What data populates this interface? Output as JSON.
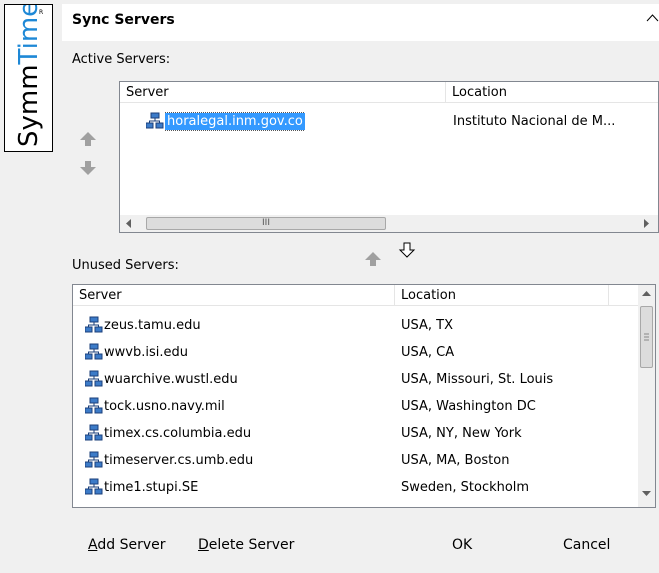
{
  "logo": {
    "text": "SymmTime",
    "mark": "R"
  },
  "section": {
    "title": "Sync Servers"
  },
  "active": {
    "label": "Active Servers:",
    "columns": [
      "Server",
      "Location"
    ],
    "rows": [
      {
        "server": "horalegal.inm.gov.co",
        "location": "Instituto Nacional de M..."
      }
    ],
    "hscroll_grip": "III"
  },
  "unused": {
    "label": "Unused Servers:",
    "columns": [
      "Server",
      "Location"
    ],
    "rows": [
      {
        "server": "zeus.tamu.edu",
        "location": "USA, TX"
      },
      {
        "server": "wwvb.isi.edu",
        "location": "USA, CA"
      },
      {
        "server": "wuarchive.wustl.edu",
        "location": "USA, Missouri, St. Louis"
      },
      {
        "server": "tock.usno.navy.mil",
        "location": "USA, Washington DC"
      },
      {
        "server": "timex.cs.columbia.edu",
        "location": "USA, NY, New York"
      },
      {
        "server": "timeserver.cs.umb.edu",
        "location": "USA, MA, Boston"
      },
      {
        "server": "time1.stupi.SE",
        "location": "Sweden, Stockholm"
      }
    ]
  },
  "buttons": {
    "add": {
      "accel": "A",
      "rest": "dd Server"
    },
    "delete": {
      "accel": "D",
      "rest": "elete Server"
    },
    "ok": "OK",
    "cancel": "Cancel"
  },
  "icons": {
    "server": "network-server-icon",
    "move_up": "arrow-up-icon",
    "move_down": "arrow-down-icon",
    "collapse": "chevron-up-icon"
  },
  "colors": {
    "selection": "#3399ff",
    "arrow_gray": "#a0a0a0",
    "logo_blue": "#1e88d6"
  }
}
